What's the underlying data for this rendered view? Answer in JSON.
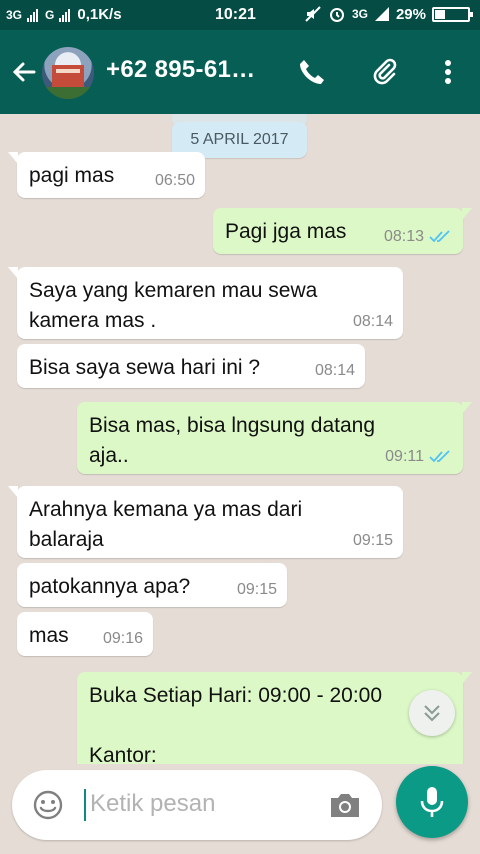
{
  "status_bar": {
    "network_left": "3G",
    "network_mid": "G",
    "speed": "0,1K/s",
    "time": "10:21",
    "network_right": "3G",
    "battery_percent_label": "29%",
    "battery_level": 0.29
  },
  "toolbar": {
    "contact_title": "+62 895-61…",
    "icons": [
      "back-arrow-icon",
      "avatar",
      "phone-icon",
      "attach-icon",
      "more-icon"
    ]
  },
  "chat": {
    "date_chip_ghost": "5 APRIL 2017",
    "date_chip": "5 APRIL 2017",
    "messages": [
      {
        "dir": "in",
        "text": "pagi mas",
        "time": "06:50"
      },
      {
        "dir": "out",
        "text": "Pagi jga mas",
        "time": "08:13",
        "read": true
      },
      {
        "dir": "in",
        "text": "Saya yang kemaren mau sewa\nkamera mas .",
        "time": "08:14"
      },
      {
        "dir": "in",
        "text": "Bisa saya sewa hari ini ?",
        "time": "08:14"
      },
      {
        "dir": "out",
        "text": "Bisa mas, bisa lngsung datang\naja..",
        "time": "09:11",
        "read": true
      },
      {
        "dir": "in",
        "text": "Arahnya kemana ya mas dari\nbalaraja",
        "time": "09:15"
      },
      {
        "dir": "in",
        "text": "patokannya apa?",
        "time": "09:15"
      },
      {
        "dir": "in",
        "text": "mas",
        "time": "09:16"
      },
      {
        "dir": "out",
        "text": "Buka Setiap Hari: 09:00 - 20:00\n\nKantor:",
        "time": ""
      }
    ]
  },
  "input": {
    "placeholder": "Ketik pesan"
  },
  "colors": {
    "status_bar": "#054d44",
    "toolbar": "#075e54",
    "chat_bg": "#e5ddd5",
    "bubble_out": "#dcf8c6",
    "bubble_in": "#ffffff",
    "read_tick": "#4fc3f7",
    "fab": "#0b9a86"
  }
}
